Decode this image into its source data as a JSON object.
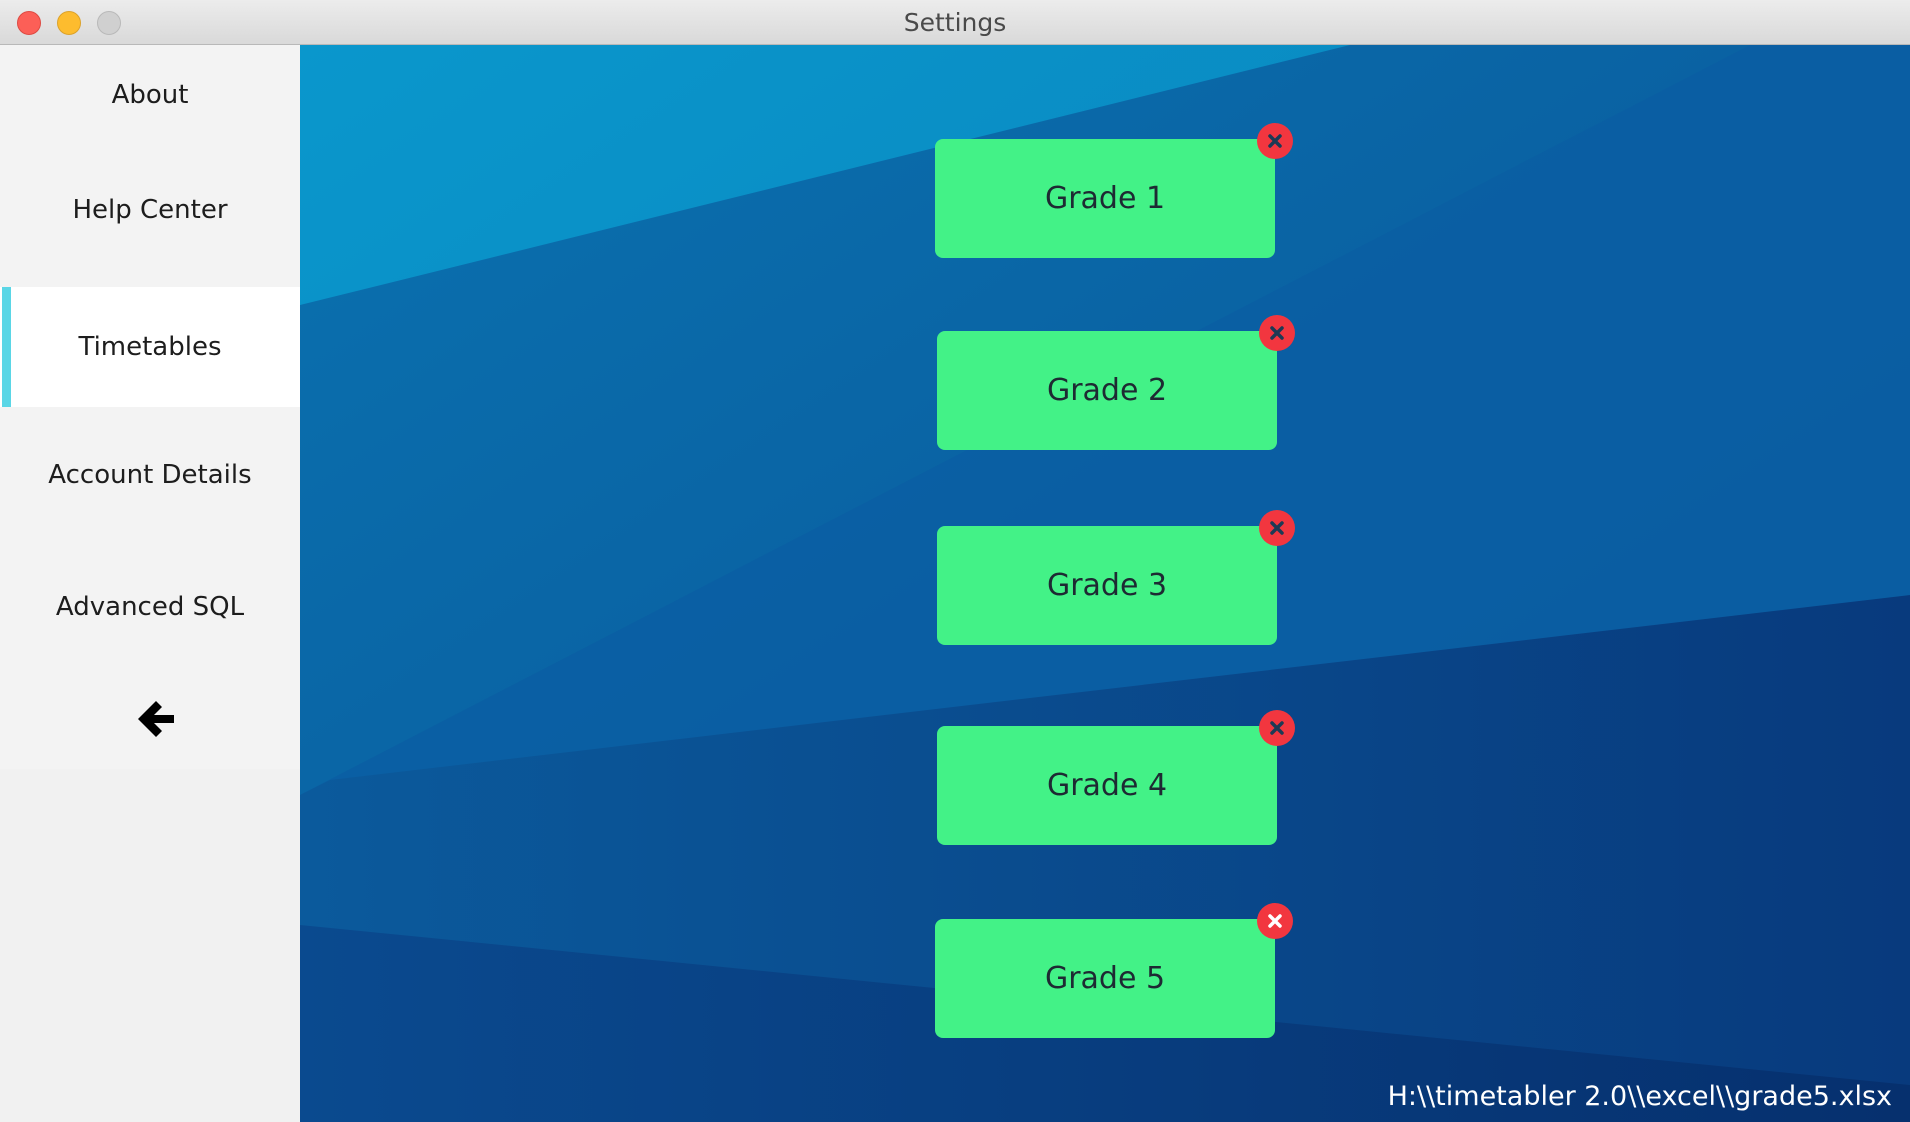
{
  "window": {
    "title": "Settings"
  },
  "sidebar": {
    "items": [
      {
        "label": "About",
        "active": false
      },
      {
        "label": "Help Center",
        "active": false
      },
      {
        "label": "Timetables",
        "active": true
      },
      {
        "label": "Account Details",
        "active": false
      },
      {
        "label": "Advanced SQL",
        "active": false
      }
    ],
    "back_icon": "arrow-left-icon"
  },
  "grades": [
    {
      "label": "Grade 1"
    },
    {
      "label": "Grade 2"
    },
    {
      "label": "Grade 3"
    },
    {
      "label": "Grade 4"
    },
    {
      "label": "Grade 5"
    }
  ],
  "status": {
    "file_path": "H:\\\\timetabler 2.0\\\\excel\\\\grade5.xlsx"
  },
  "colors": {
    "grade_button": "#43f287",
    "remove_icon": "#f2363f",
    "active_indicator": "#5ad6e6",
    "sidebar_bg": "#f3f3f3"
  }
}
